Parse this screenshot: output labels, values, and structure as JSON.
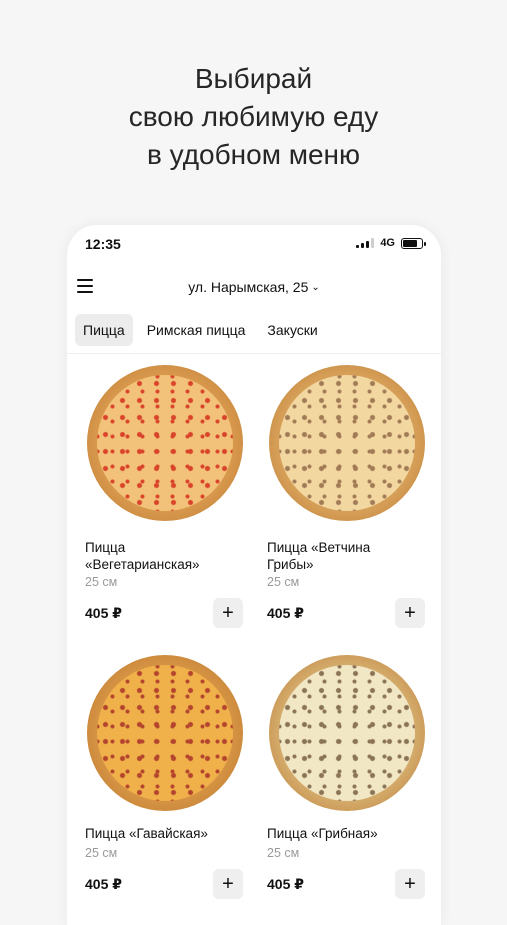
{
  "headline": {
    "line1": "Выбирай",
    "line2": "свою любимую еду",
    "line3": "в удобном меню"
  },
  "status": {
    "time": "12:35",
    "network": "4G"
  },
  "header": {
    "address": "ул. Нарымская, 25",
    "chevron": "⌄"
  },
  "tabs": [
    {
      "label": "Пицца",
      "active": true
    },
    {
      "label": "Римская пицца",
      "active": false
    },
    {
      "label": "Закуски",
      "active": false
    }
  ],
  "products": [
    {
      "title_line1": "Пицца",
      "title_line2": "«Вегетарианская»",
      "size": "25 см",
      "price": "405 ₽",
      "add": "+",
      "crust": "#d99a4e",
      "cheese": "#f2c27a",
      "topping": "#d9432a"
    },
    {
      "title_line1": "Пицца «Ветчина",
      "title_line2": "Грибы»",
      "size": "25 см",
      "price": "405 ₽",
      "add": "+",
      "crust": "#d8a25a",
      "cheese": "#f3d7a0",
      "topping": "#a07b55"
    },
    {
      "title_line1": "Пицца «Гавайская»",
      "title_line2": "",
      "size": "25 см",
      "price": "405 ₽",
      "add": "+",
      "crust": "#d69444",
      "cheese": "#f0b04a",
      "topping": "#b3452e"
    },
    {
      "title_line1": "Пицца «Грибная»",
      "title_line2": "",
      "size": "25 см",
      "price": "405 ₽",
      "add": "+",
      "crust": "#d5ad6d",
      "cheese": "#f1e7c4",
      "topping": "#8a7356"
    }
  ]
}
